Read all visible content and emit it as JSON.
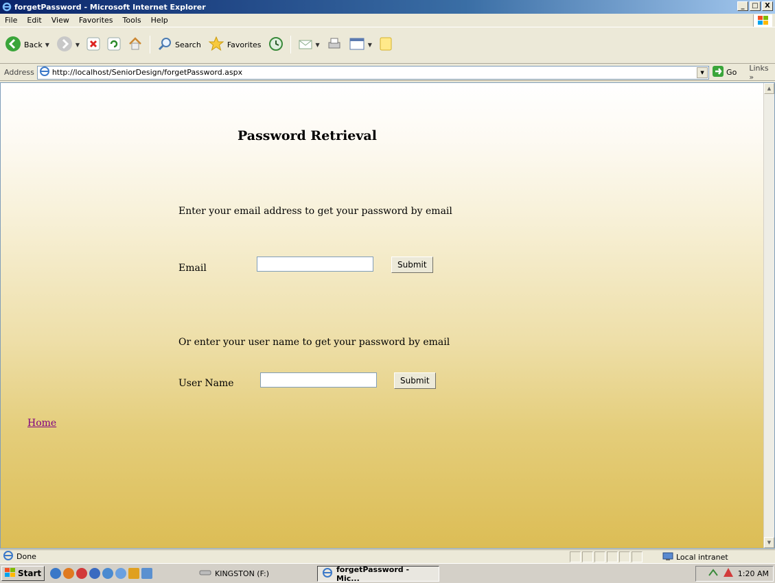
{
  "window": {
    "title": "forgetPassword - Microsoft Internet Explorer",
    "controls": [
      "_",
      "□",
      "X"
    ]
  },
  "menu": [
    "File",
    "Edit",
    "View",
    "Favorites",
    "Tools",
    "Help"
  ],
  "toolbar": {
    "back_label": "Back",
    "search_label": "Search",
    "favorites_label": "Favorites"
  },
  "address": {
    "label": "Address",
    "url": "http://localhost/SeniorDesign/forgetPassword.aspx",
    "go_label": "Go",
    "links_label": "Links »"
  },
  "page": {
    "title": "Password Retrieval",
    "email_instruction": "Enter your email address to get your password by email",
    "email_label": "Email",
    "email_value": "",
    "email_submit": "Submit",
    "username_instruction": "Or enter your user name to get your password by email",
    "username_label": "User Name",
    "username_value": "",
    "username_submit": "Submit",
    "home_link": "Home"
  },
  "status": {
    "text": "Done",
    "zone": "Local intranet"
  },
  "taskbar": {
    "start_label": "Start",
    "tasks": [
      "KINGSTON (F:)",
      "forgetPassword - Mic..."
    ],
    "clock": "1:20 AM"
  },
  "colors": {
    "titlebar": "#0a246a",
    "visited_link": "#800080",
    "page_gradient_bottom": "#dcbd55"
  }
}
